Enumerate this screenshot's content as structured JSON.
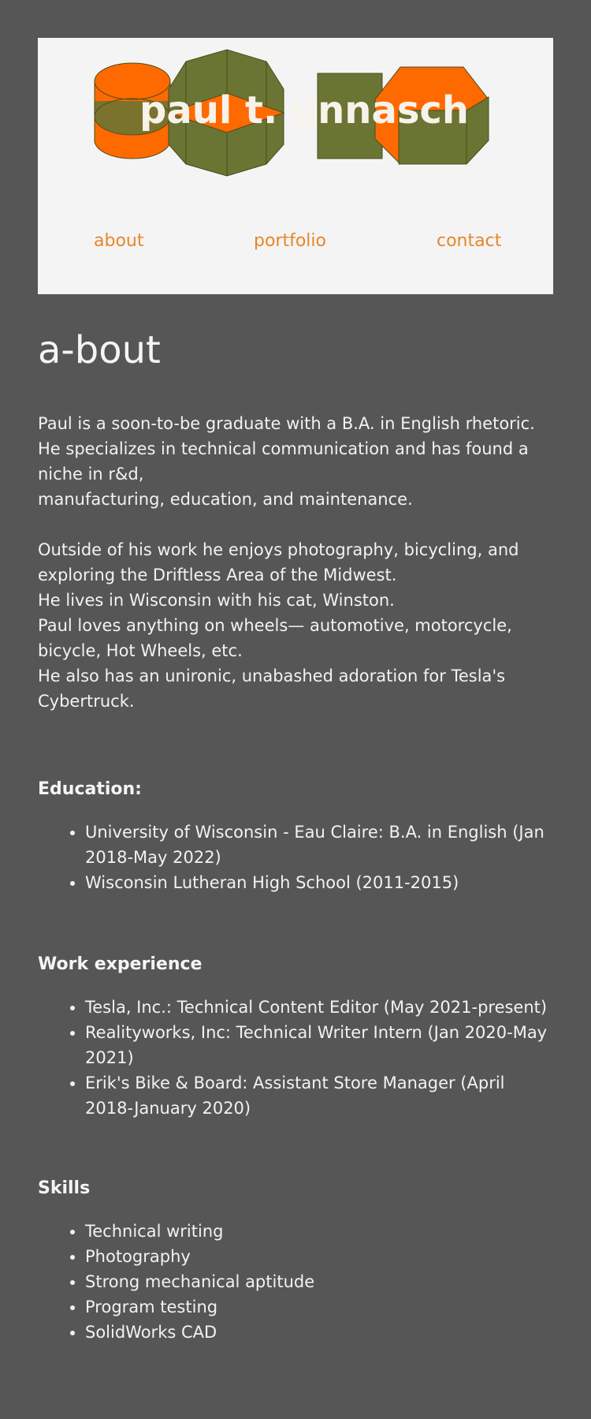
{
  "header": {
    "logo_text": "paul t. unnasch",
    "nav": {
      "about": "about",
      "portfolio": "portfolio",
      "contact": "contact"
    }
  },
  "page": {
    "title": "a-bout",
    "intro": [
      "Paul is a soon-to-be graduate with a B.A. in English rhetoric.",
      "He specializes in technical communication and has found a niche in r&d,",
      "manufacturing, education, and maintenance."
    ],
    "personal": [
      "Outside of his work he enjoys photography, bicycling, and exploring the Driftless Area of the Midwest.",
      "He lives in Wisconsin with his cat, Winston.",
      "Paul loves anything on wheels— automotive, motorcycle, bicycle, Hot Wheels, etc.",
      "He also has an unironic, unabashed adoration for Tesla's Cybertruck."
    ]
  },
  "education": {
    "heading": "Education:",
    "items": [
      "University of Wisconsin - Eau Claire: B.A. in English (Jan 2018-May 2022)",
      "Wisconsin Lutheran High School (2011-2015)"
    ]
  },
  "work": {
    "heading": "Work experience",
    "items": [
      "Tesla, Inc.: Technical Content Editor (May 2021-present)",
      "Realityworks, Inc: Technical Writer Intern (Jan 2020-May 2021)",
      "Erik's Bike & Board: Assistant Store Manager (April 2018-January 2020)"
    ]
  },
  "skills": {
    "heading": "Skills",
    "items": [
      "Technical writing",
      "Photography",
      "Strong mechanical aptitude",
      "Program testing",
      "SolidWorks CAD"
    ]
  },
  "colors": {
    "background": "#565656",
    "header_bg": "#f4f4f4",
    "accent_orange": "#ff6a00",
    "accent_olive": "#6b7533",
    "nav_link": "#e8862a"
  }
}
